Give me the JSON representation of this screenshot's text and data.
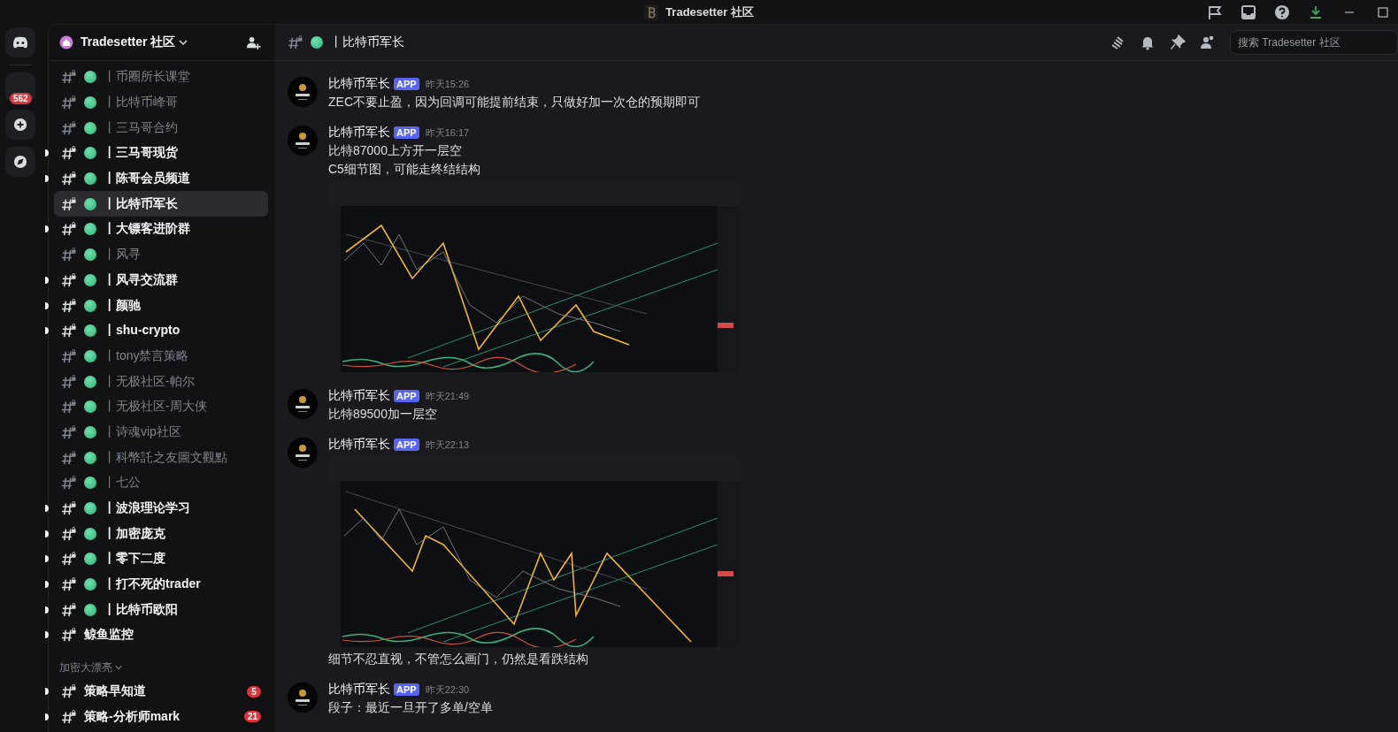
{
  "titlebar": {
    "title": "Tradesetter 社区"
  },
  "server_rail": {
    "badge": "562"
  },
  "server": {
    "name": "Tradesetter 社区"
  },
  "channels": [
    {
      "name": "丨币圈所长课堂",
      "kind": "status",
      "unread": false,
      "selected": false
    },
    {
      "name": "丨比特币峰哥",
      "kind": "status",
      "unread": false,
      "selected": false
    },
    {
      "name": "丨三马哥合约",
      "kind": "status",
      "unread": false,
      "selected": false
    },
    {
      "name": "丨三马哥现货",
      "kind": "status",
      "unread": true,
      "selected": false
    },
    {
      "name": "丨陈哥会员频道",
      "kind": "status",
      "unread": true,
      "selected": false
    },
    {
      "name": "丨比特币军长",
      "kind": "status",
      "unread": false,
      "selected": true
    },
    {
      "name": "丨大镖客进阶群",
      "kind": "status",
      "unread": true,
      "selected": false
    },
    {
      "name": "丨风寻",
      "kind": "status",
      "unread": false,
      "selected": false
    },
    {
      "name": "丨风寻交流群",
      "kind": "status",
      "unread": true,
      "selected": false
    },
    {
      "name": "丨颜驰",
      "kind": "status",
      "unread": true,
      "selected": false
    },
    {
      "name": "丨shu-crypto",
      "kind": "status",
      "unread": true,
      "selected": false
    },
    {
      "name": "丨tony禁言策略",
      "kind": "status",
      "unread": false,
      "selected": false
    },
    {
      "name": "丨无极社区-帕尔",
      "kind": "status",
      "unread": false,
      "selected": false
    },
    {
      "name": "丨无极社区-周大侠",
      "kind": "status",
      "unread": false,
      "selected": false
    },
    {
      "name": "丨诗魂vip社区",
      "kind": "status",
      "unread": false,
      "selected": false
    },
    {
      "name": "丨科幣託之友圖文觀點",
      "kind": "status",
      "unread": false,
      "selected": false
    },
    {
      "name": "丨七公",
      "kind": "status",
      "unread": false,
      "selected": false
    },
    {
      "name": "丨波浪理论学习",
      "kind": "status",
      "unread": true,
      "selected": false
    },
    {
      "name": "丨加密庞克",
      "kind": "status",
      "unread": true,
      "selected": false
    },
    {
      "name": "丨零下二度",
      "kind": "status",
      "unread": true,
      "selected": false
    },
    {
      "name": "丨打不死的trader",
      "kind": "status",
      "unread": true,
      "selected": false
    },
    {
      "name": "丨比特币欧阳",
      "kind": "status",
      "unread": true,
      "selected": false
    },
    {
      "name": "鲸鱼监控",
      "kind": "plain",
      "unread": true,
      "selected": false
    }
  ],
  "category": {
    "name": "加密大漂亮",
    "channels": [
      {
        "name": "策略早知道",
        "kind": "plain",
        "unread": true,
        "selected": false,
        "badge": "5"
      },
      {
        "name": "策略-分析师mark",
        "kind": "plain",
        "unread": true,
        "selected": false,
        "badge": "21"
      }
    ]
  },
  "header": {
    "channel": "丨比特币军长",
    "search": {
      "placeholder": "搜索 Tradesetter 社区"
    }
  },
  "messages": [
    {
      "author": "比特币军长",
      "tag": "APP",
      "time": "昨天15:26",
      "blocks": [
        {
          "kind": "text",
          "text": "ZEC不要止盈，因为回调可能提前结束，只做好加一次仓的预期即可"
        }
      ]
    },
    {
      "author": "比特币军长",
      "tag": "APP",
      "time": "昨天16:17",
      "blocks": [
        {
          "kind": "text",
          "text": "比特87000上方开一层空"
        },
        {
          "kind": "text",
          "text": "C5细节图，可能走终结结构"
        },
        {
          "kind": "picture"
        }
      ]
    },
    {
      "author": "比特币军长",
      "tag": "APP",
      "time": "昨天21:49",
      "blocks": [
        {
          "kind": "text",
          "text": "比特89500加一层空"
        }
      ]
    },
    {
      "author": "比特币军长",
      "tag": "APP",
      "time": "昨天22:13",
      "blocks": [
        {
          "kind": "picture"
        },
        {
          "kind": "text",
          "text": "细节不忍直视，不管怎么画门，仍然是看跌结构"
        }
      ]
    },
    {
      "author": "比特币军长",
      "tag": "APP",
      "time": "昨天22:30",
      "blocks": [
        {
          "kind": "text",
          "text": "段子：最近一旦开了多单/空单"
        }
      ]
    }
  ]
}
